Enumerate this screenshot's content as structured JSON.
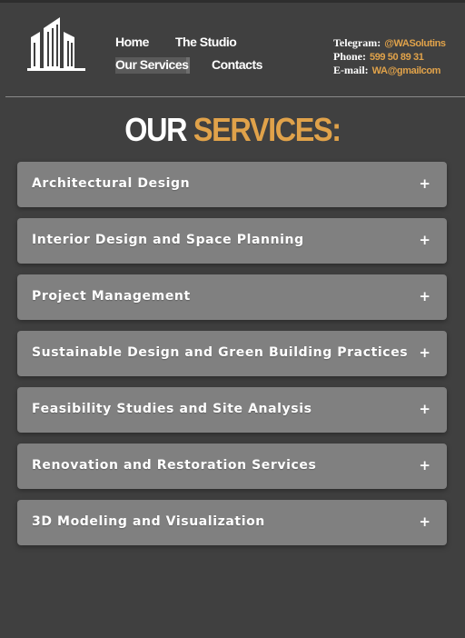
{
  "nav": {
    "home": "Home",
    "studio": "The Studio",
    "services": "Our Services",
    "contacts": "Contacts"
  },
  "contact": {
    "telegram_label": "Telegram:",
    "telegram_value": "@WASolutins",
    "phone_label": "Phone:",
    "phone_value": "599 50 89 31",
    "email_label": "E-mail:",
    "email_value": "WA@gmailcom"
  },
  "title": {
    "word1": "OUR",
    "word2": "SERVICES:"
  },
  "services": [
    {
      "label": "Architectural Design",
      "toggle": "+"
    },
    {
      "label": "Interior Design and Space Planning",
      "toggle": "+"
    },
    {
      "label": "Project Management",
      "toggle": "+"
    },
    {
      "label": "Sustainable Design and Green Building Practices",
      "toggle": "+"
    },
    {
      "label": "Feasibility Studies and Site Analysis",
      "toggle": "+"
    },
    {
      "label": "Renovation and Restoration Services",
      "toggle": "+"
    },
    {
      "label": "3D Modeling and Visualization",
      "toggle": "+"
    }
  ],
  "colors": {
    "background": "#404040",
    "accent": "#e0a24a",
    "card": "#808080"
  }
}
